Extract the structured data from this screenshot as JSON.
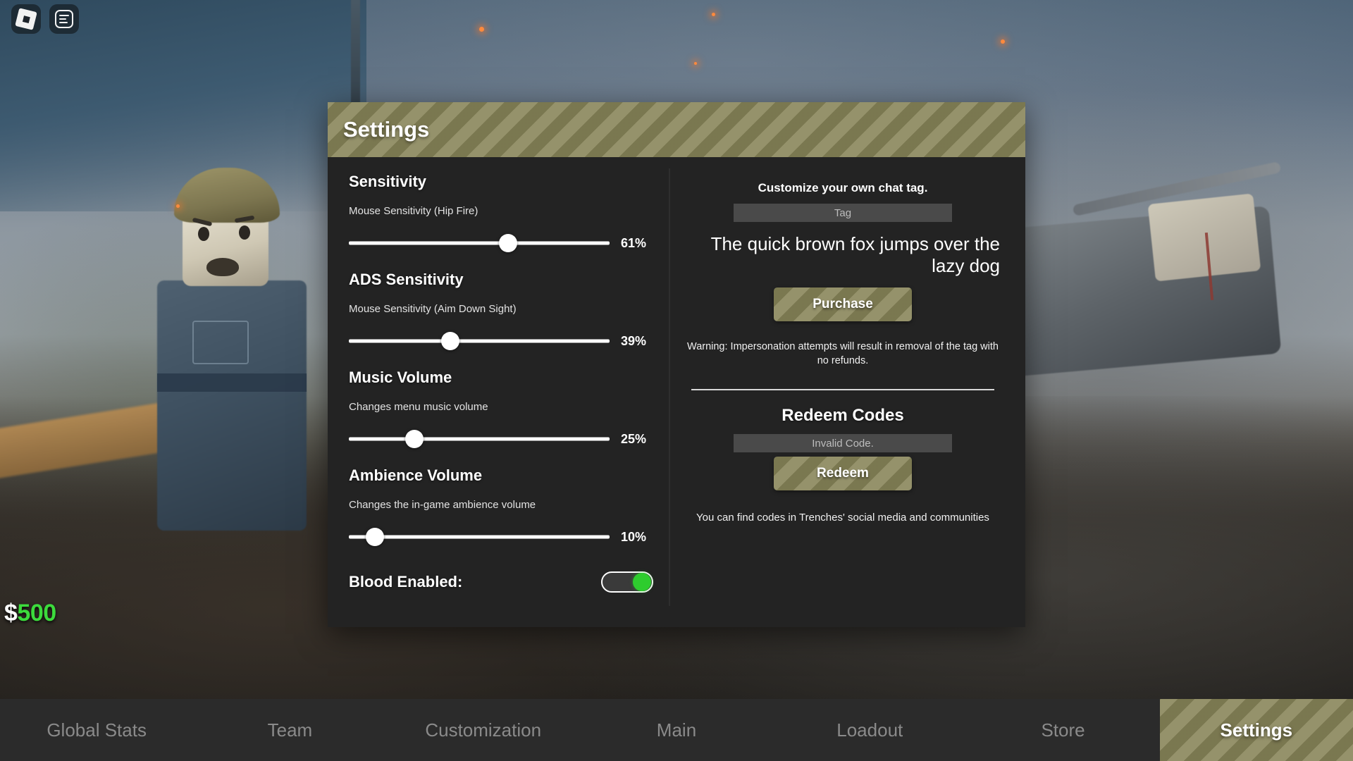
{
  "window": {
    "cash_symbol": "$",
    "cash_amount": "500"
  },
  "top_icons": [
    {
      "name": "roblox-logo-icon",
      "label": "Roblox"
    },
    {
      "name": "menu-list-icon",
      "label": "Menu"
    }
  ],
  "panel": {
    "title": "Settings"
  },
  "settings": {
    "sliders": [
      {
        "title": "Sensitivity",
        "description": "Mouse Sensitivity (Hip Fire)",
        "value": 61,
        "value_label": "61%"
      },
      {
        "title": "ADS Sensitivity",
        "description": "Mouse Sensitivity (Aim Down Sight)",
        "value": 39,
        "value_label": "39%"
      },
      {
        "title": "Music Volume",
        "description": "Changes menu music volume",
        "value": 25,
        "value_label": "25%"
      },
      {
        "title": "Ambience Volume",
        "description": "Changes the in-game ambience volume",
        "value": 10,
        "value_label": "10%"
      }
    ],
    "toggle": {
      "label": "Blood Enabled:",
      "state": "on"
    }
  },
  "chat_tag": {
    "heading": "Customize your own chat tag.",
    "input_placeholder": "Tag",
    "input_value": "",
    "preview_text": "The quick brown fox jumps over the lazy dog",
    "purchase_label": "Purchase",
    "warning": "Warning: Impersonation attempts will result in removal of the tag with no refunds."
  },
  "redeem": {
    "title": "Redeem Codes",
    "input_status": "Invalid Code.",
    "redeem_label": "Redeem",
    "note": "You can find codes in Trenches' social media and communities"
  },
  "bottom_nav": {
    "items": [
      {
        "label": "Global Stats",
        "active": false
      },
      {
        "label": "Team",
        "active": false
      },
      {
        "label": "Customization",
        "active": false
      },
      {
        "label": "Main",
        "active": false
      },
      {
        "label": "Loadout",
        "active": false
      },
      {
        "label": "Store",
        "active": false
      },
      {
        "label": "Settings",
        "active": true
      }
    ]
  },
  "colors": {
    "panel_bg": "#232323",
    "accent_olive": "#888559",
    "toggle_on": "#2ecc2e",
    "cash_green": "#3cdb3c",
    "nav_bg": "#2b2b2b"
  }
}
